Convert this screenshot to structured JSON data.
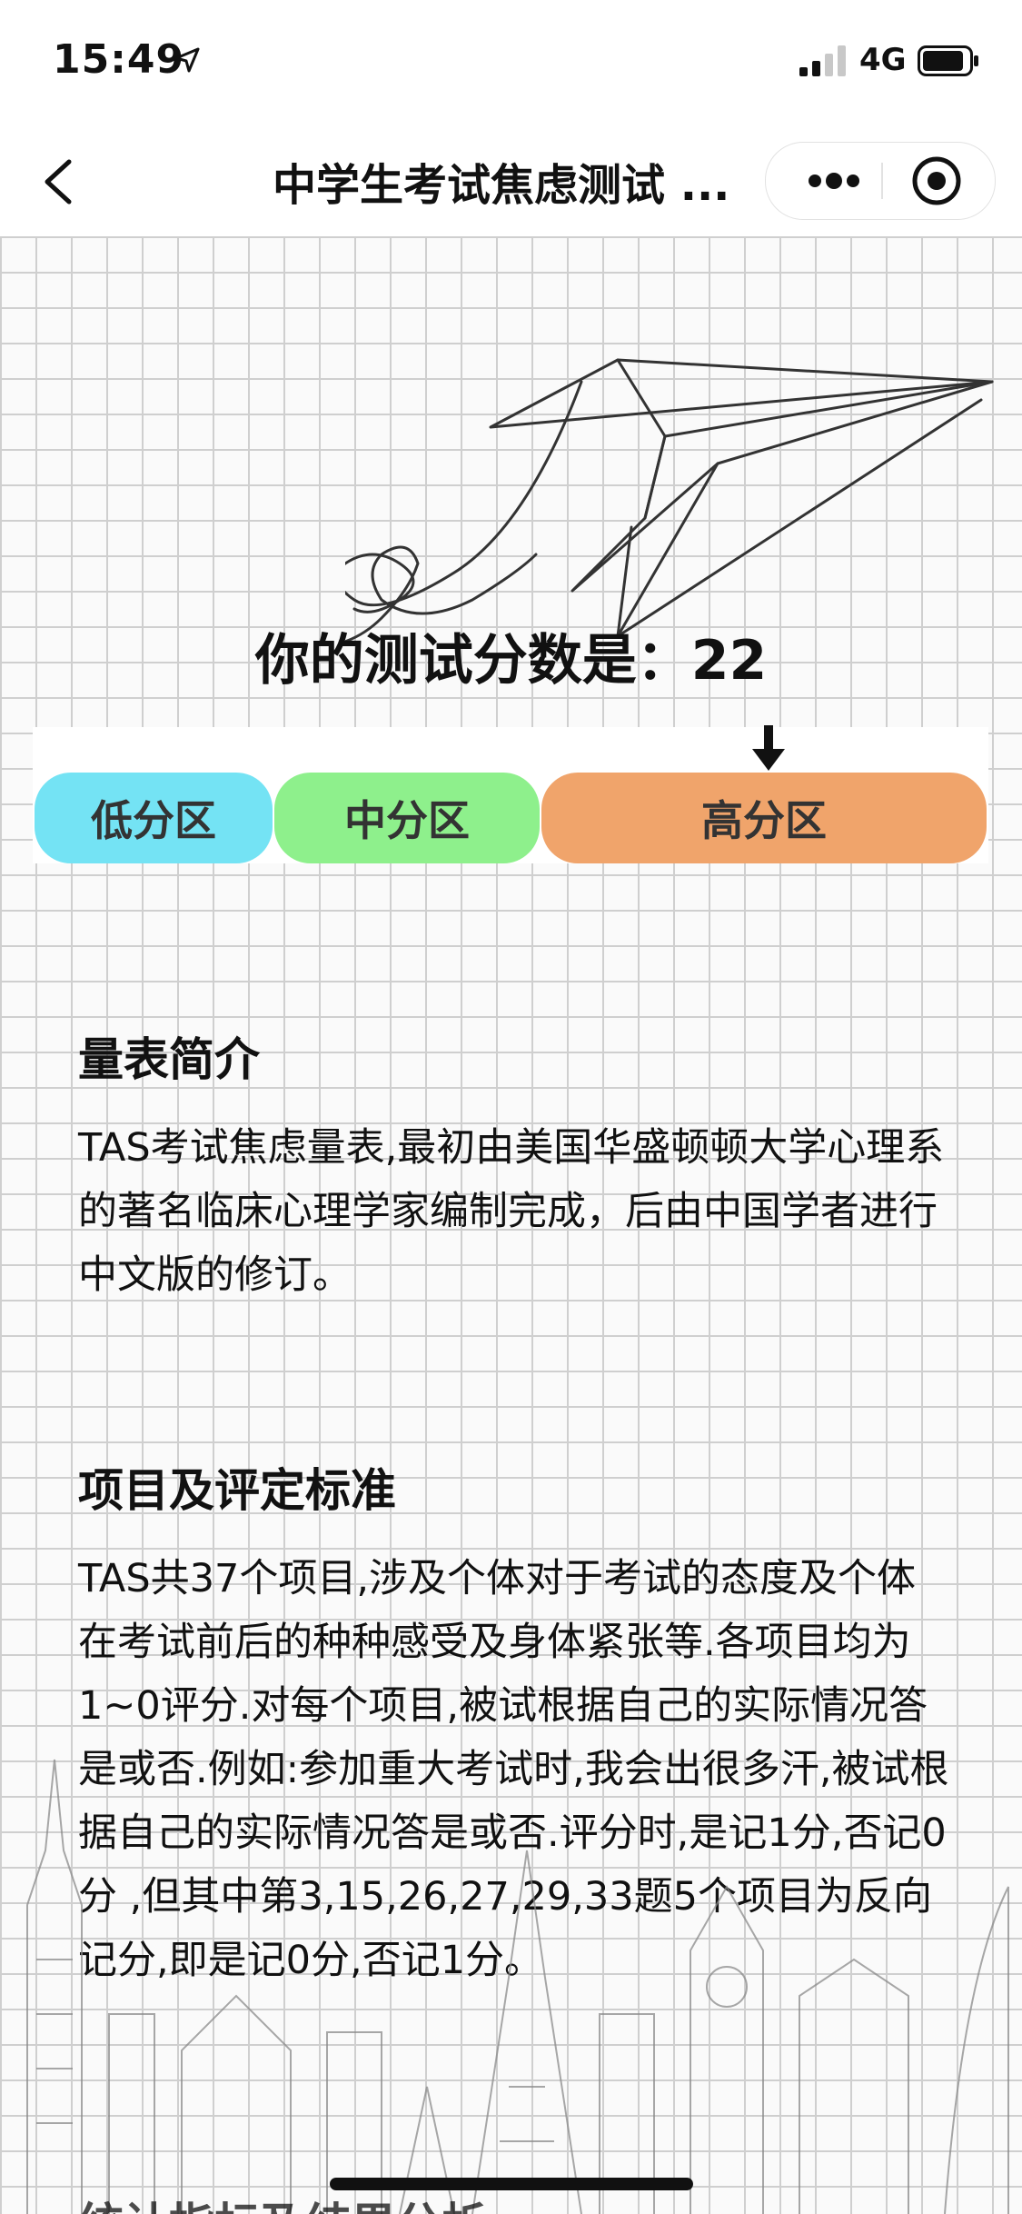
{
  "status_bar": {
    "time": "15:49",
    "network": "4G"
  },
  "nav": {
    "title": "中学生考试焦虑测试 ..."
  },
  "result": {
    "score_label": "你的测试分数是：",
    "score": "22",
    "zones": [
      {
        "label": "低分区",
        "color": "#74e3f4"
      },
      {
        "label": "中分区",
        "color": "#8ef08c"
      },
      {
        "label": "高分区",
        "color": "#f0a46b"
      }
    ],
    "current_zone": "高分区"
  },
  "sections": [
    {
      "heading": "量表简介",
      "text": "TAS考试焦虑量表,最初由美国华盛顿顿大学心理系的著名临床心理学家编制完成，后由中国学者进行中文版的修订。"
    },
    {
      "heading": "项目及评定标准",
      "text": "TAS共37个项目,涉及个体对于考试的态度及个体在考试前后的种种感受及身体紧张等.各项目均为1~0评分.对每个项目,被试根据自己的实际情况答是或否.例如:参加重大考试时,我会出很多汗,被试根据自己的实际情况答是或否.评分时,是记1分,否记0分 ,但其中第3,15,26,27,29,33题5个项目为反向记分,即是记0分,否记1分。"
    },
    {
      "heading": "统计指标及结果分析"
    }
  ]
}
